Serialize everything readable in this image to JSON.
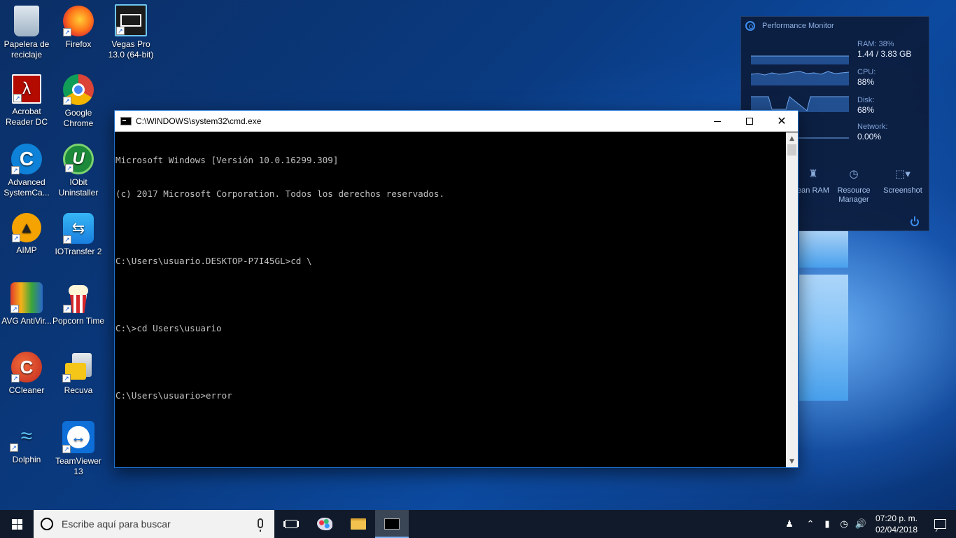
{
  "desktop": {
    "icons": [
      {
        "label": "Papelera de reciclaje"
      },
      {
        "label": "Firefox"
      },
      {
        "label": "Vegas Pro 13.0 (64-bit)"
      },
      {
        "label": "Acrobat Reader DC"
      },
      {
        "label": "Google Chrome"
      },
      {
        "label": "Advanced SystemCa..."
      },
      {
        "label": "IObit Uninstaller"
      },
      {
        "label": "AIMP"
      },
      {
        "label": "IOTransfer 2"
      },
      {
        "label": "AVG AntiVir..."
      },
      {
        "label": "Popcorn Time"
      },
      {
        "label": "CCleaner"
      },
      {
        "label": "Recuva"
      },
      {
        "label": "Dolphin"
      },
      {
        "label": "TeamViewer 13"
      }
    ]
  },
  "cmd": {
    "title": "C:\\WINDOWS\\system32\\cmd.exe",
    "lines": [
      "Microsoft Windows [Versión 10.0.16299.309]",
      "(c) 2017 Microsoft Corporation. Todos los derechos reservados.",
      "",
      "C:\\Users\\usuario.DESKTOP-P7I45GL>cd \\",
      "",
      "C:\\>cd Users\\usuario",
      "",
      "C:\\Users\\usuario>error"
    ]
  },
  "perf_monitor": {
    "title": "Performance Monitor",
    "ram_label": "RAM: 38%",
    "ram_value": "1.44 / 3.83 GB",
    "cpu_label": "CPU:",
    "cpu_value": "88%",
    "disk_label": "Disk:",
    "disk_value": "68%",
    "network_label": "Network:",
    "network_value": "0.00%",
    "tools": {
      "clean_ram": "ean RAM",
      "resource_manager": "Resource Manager",
      "screenshot": "Screenshot"
    }
  },
  "taskbar": {
    "search_placeholder": "Escribe aquí para buscar",
    "time": "07:20 p. m.",
    "date": "02/04/2018"
  }
}
